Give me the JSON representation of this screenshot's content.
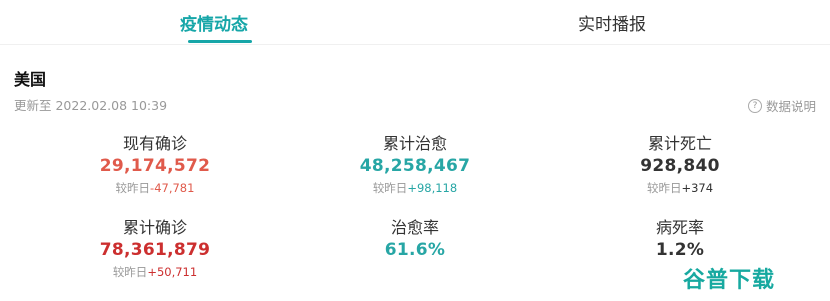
{
  "tabs": [
    {
      "label": "疫情动态",
      "active": true
    },
    {
      "label": "实时播报",
      "active": false
    }
  ],
  "region": "美国",
  "updated": "更新至 2022.02.08 10:39",
  "explain_label": "数据说明",
  "stats": {
    "current_confirmed": {
      "label": "现有确诊",
      "value": "29,174,572",
      "delta_prefix": "较昨日",
      "delta": "-47,781"
    },
    "total_cured": {
      "label": "累计治愈",
      "value": "48,258,467",
      "delta_prefix": "较昨日",
      "delta": "+98,118"
    },
    "total_deaths": {
      "label": "累计死亡",
      "value": "928,840",
      "delta_prefix": "较昨日",
      "delta": "+374"
    },
    "total_confirmed": {
      "label": "累计确诊",
      "value": "78,361,879",
      "delta_prefix": "较昨日",
      "delta": "+50,711"
    },
    "cure_rate": {
      "label": "治愈率",
      "value": "61.6%"
    },
    "death_rate": {
      "label": "病死率",
      "value": "1.2%"
    }
  },
  "watermark": "谷普下载",
  "colors": {
    "accent": "#16a6a8",
    "confirmed": "#e05a4b",
    "confirmed_total": "#cc2f2f",
    "cured": "#27a6a5",
    "deaths": "#333333"
  }
}
